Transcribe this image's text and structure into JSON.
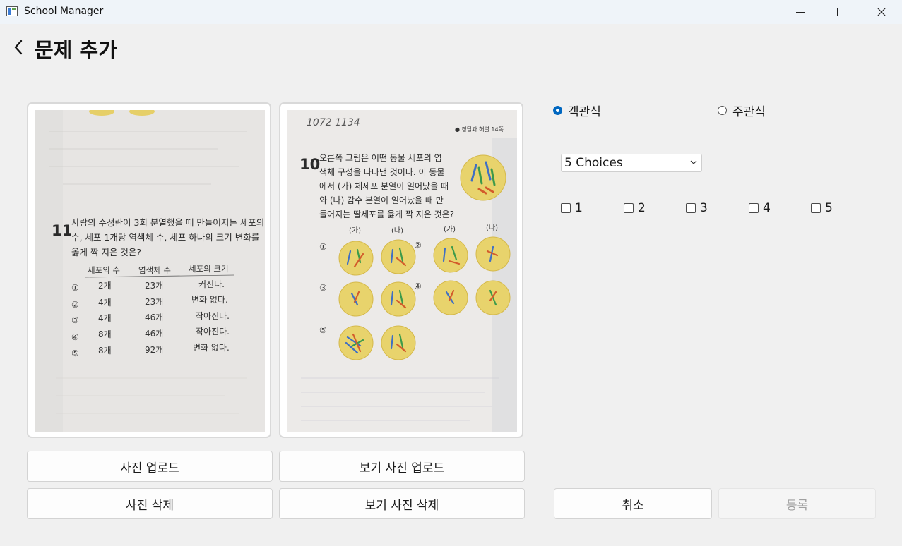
{
  "window": {
    "title": "School Manager",
    "controls": [
      "minimize",
      "maximize",
      "close"
    ]
  },
  "header": {
    "back_icon": "chevron-left-icon",
    "title": "문제 추가"
  },
  "images": {
    "question_photo": {
      "number": "11",
      "lines": [
        "사람의 수정란이 3회 분열했을 때 만들어지는 세포의",
        "수, 세포 1개당 염색체 수, 세포 하나의 크기 변화를",
        "옳게 짝 지은 것은?"
      ],
      "table_headers": [
        "세포의 수",
        "염색체 수",
        "세포의 크기"
      ],
      "rows": [
        [
          "①",
          "2개",
          "23개",
          "커진다."
        ],
        [
          "②",
          "4개",
          "23개",
          "변화 없다."
        ],
        [
          "③",
          "4개",
          "46개",
          "작아진다."
        ],
        [
          "④",
          "8개",
          "46개",
          "작아진다."
        ],
        [
          "⑤",
          "8개",
          "92개",
          "변화 없다."
        ]
      ]
    },
    "choice_photo": {
      "handwriting": "1072  1134",
      "page_note": "● 정답과 해설 14쪽",
      "number": "10",
      "lines": [
        "오른쪽 그림은 어떤 동물 세포의 염",
        "색체 구성을 나타낸 것이다. 이 동물",
        "에서 (가) 체세포 분열이 일어났을 때",
        "와 (나) 감수 분열이 일어났을 때 만",
        "들어지는 딸세포를 옳게 짝 지은 것은?"
      ],
      "labels": [
        "(가)",
        "(나)",
        "(가)",
        "(나)"
      ],
      "numerals": [
        "①",
        "②",
        "③",
        "④",
        "⑤"
      ]
    }
  },
  "buttons": {
    "upload_photo": "사진 업로드",
    "delete_photo": "사진 삭제",
    "upload_choice_photo": "보기 사진 업로드",
    "delete_choice_photo": "보기 사진 삭제",
    "cancel": "취소",
    "register": "등록"
  },
  "question_type": {
    "options": [
      "객관식",
      "주관식"
    ],
    "selected": "객관식"
  },
  "choices": {
    "dropdown_value": "5 Choices",
    "items": [
      "1",
      "2",
      "3",
      "4",
      "5"
    ]
  },
  "colors": {
    "accent": "#0067c0",
    "window_bg": "#f0f0f0",
    "titlebar_bg": "#eff4f9"
  }
}
